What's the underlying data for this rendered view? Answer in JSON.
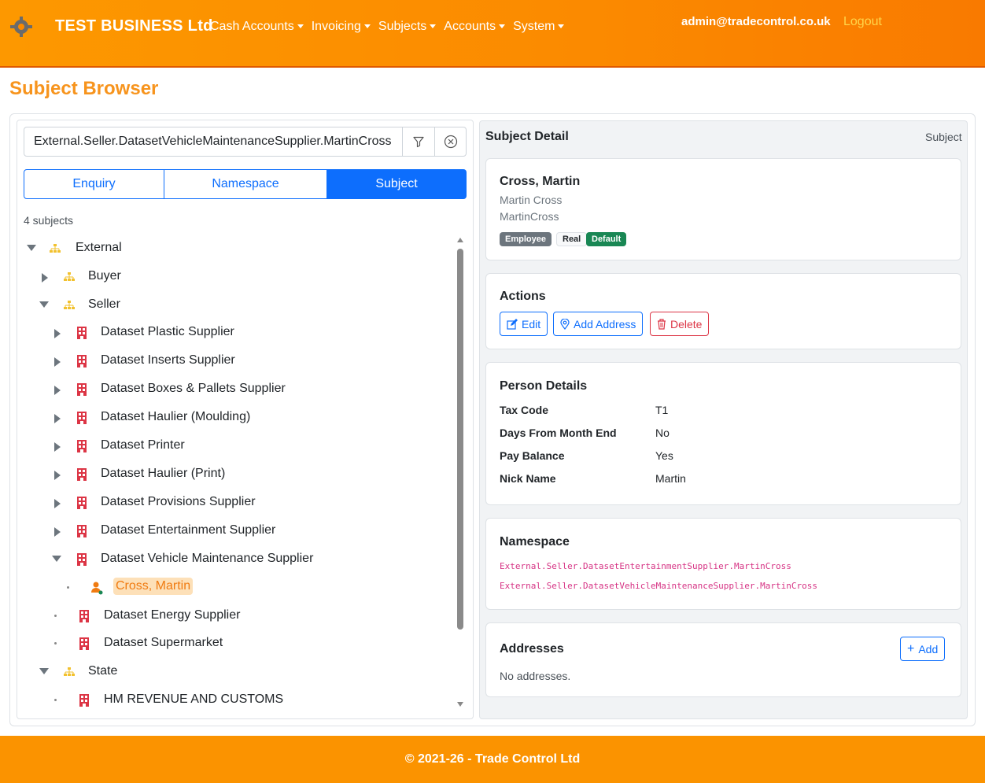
{
  "navbar": {
    "brand": "TEST BUSINESS Ltd",
    "menu": [
      "Cash Accounts",
      "Invoicing",
      "Subjects",
      "Accounts",
      "System"
    ],
    "user": "admin@tradecontrol.co.uk",
    "logout": "Logout"
  },
  "page_title": "Subject Browser",
  "search": {
    "value": "External.Seller.DatasetVehicleMaintenanceSupplier.MartinCross"
  },
  "tabs": [
    "Enquiry",
    "Namespace",
    "Subject"
  ],
  "active_tab": "Subject",
  "subject_count": "4 subjects",
  "tree": [
    {
      "label": "External"
    },
    {
      "label": "Buyer"
    },
    {
      "label": "Seller"
    },
    {
      "label": "Dataset Plastic Supplier"
    },
    {
      "label": "Dataset Inserts Supplier"
    },
    {
      "label": "Dataset Boxes & Pallets Supplier"
    },
    {
      "label": "Dataset Haulier (Moulding)"
    },
    {
      "label": "Dataset Printer"
    },
    {
      "label": "Dataset Haulier (Print)"
    },
    {
      "label": "Dataset Provisions Supplier"
    },
    {
      "label": "Dataset Entertainment Supplier"
    },
    {
      "label": "Dataset Vehicle Maintenance Supplier"
    },
    {
      "label": "Cross, Martin"
    },
    {
      "label": "Dataset Energy Supplier"
    },
    {
      "label": "Dataset Supermarket"
    },
    {
      "label": "State"
    },
    {
      "label": "HM REVENUE AND CUSTOMS"
    }
  ],
  "detail": {
    "title": "Subject Detail",
    "subtitle": "Subject",
    "name": "Cross, Martin",
    "full_name": "Martin Cross",
    "code": "MartinCross",
    "badges": [
      "Employee",
      "Real",
      "Default"
    ],
    "actions_title": "Actions",
    "actions": [
      "Edit",
      "Add Address",
      "Delete"
    ],
    "person_title": "Person Details",
    "person": [
      {
        "key": "Tax Code",
        "value": "T1"
      },
      {
        "key": "Days From Month End",
        "value": "No"
      },
      {
        "key": "Pay Balance",
        "value": "Yes"
      },
      {
        "key": "Nick Name",
        "value": "Martin"
      }
    ],
    "namespace_title": "Namespace",
    "namespaces": [
      "External.Seller.DatasetEntertainmentSupplier.MartinCross",
      "External.Seller.DatasetVehicleMaintenanceSupplier.MartinCross"
    ],
    "addresses_title": "Addresses",
    "add_label": "Add",
    "no_addresses": "No addresses."
  },
  "footer": "© 2021-26 - Trade Control Ltd",
  "colors": {
    "accent": "#fb9300",
    "primary": "#0d6efd",
    "danger": "#dc3545",
    "success": "#198754"
  }
}
